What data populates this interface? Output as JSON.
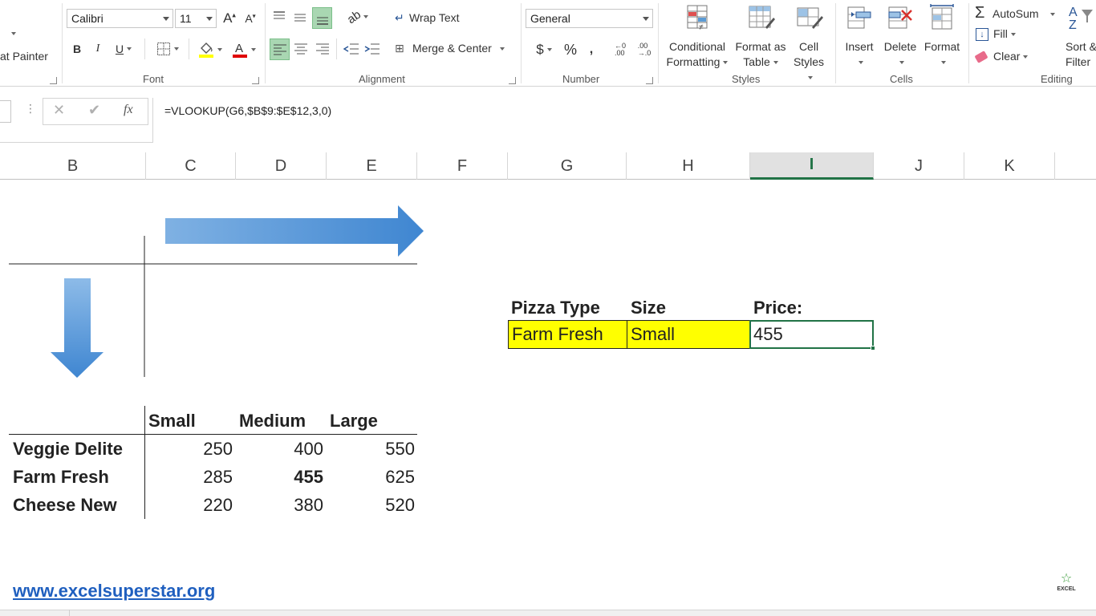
{
  "ribbon": {
    "clipboard": {
      "format_painter": "at Painter"
    },
    "font": {
      "name": "Calibri",
      "size": "11",
      "group_label": "Font"
    },
    "alignment": {
      "wrap_text": "Wrap Text",
      "merge_center": "Merge & Center",
      "group_label": "Alignment"
    },
    "number": {
      "format": "General",
      "group_label": "Number"
    },
    "styles": {
      "conditional_1": "Conditional",
      "conditional_2": "Formatting",
      "format_as_1": "Format as",
      "format_as_2": "Table",
      "cell_styles_1": "Cell",
      "cell_styles_2": "Styles",
      "group_label": "Styles"
    },
    "cells": {
      "insert": "Insert",
      "delete": "Delete",
      "format": "Format",
      "group_label": "Cells"
    },
    "editing": {
      "autosum": "AutoSum",
      "fill": "Fill",
      "clear": "Clear",
      "sort_1": "Sort &",
      "sort_2": "Filter",
      "group_label": "Editing"
    }
  },
  "formula_bar": {
    "formula": "=VLOOKUP(G6,$B$9:$E$12,3,0)"
  },
  "columns": [
    "B",
    "C",
    "D",
    "E",
    "F",
    "G",
    "H",
    "I",
    "J",
    "K"
  ],
  "selected_column": "I",
  "lookup": {
    "headers": {
      "pizza_type": "Pizza Type",
      "size": "Size",
      "price": "Price:"
    },
    "values": {
      "pizza_type": "Farm Fresh",
      "size": "Small",
      "price": "455"
    },
    "highlight_color": "#ffff00"
  },
  "price_table": {
    "headers": [
      "Small",
      "Medium",
      "Large"
    ],
    "rows": [
      {
        "name": "Veggie Delite",
        "values": [
          "250",
          "400",
          "550"
        ]
      },
      {
        "name": "Farm Fresh",
        "values": [
          "285",
          "455",
          "625"
        ]
      },
      {
        "name": "Cheese New",
        "values": [
          "220",
          "380",
          "520"
        ]
      }
    ]
  },
  "footer": {
    "website": "www.excelsuperstar.org",
    "logo_text": "EXCEL"
  },
  "colors": {
    "accent_green": "#217346",
    "arrow_blue": "#4a8fd6",
    "link_blue": "#1f5fbf"
  }
}
